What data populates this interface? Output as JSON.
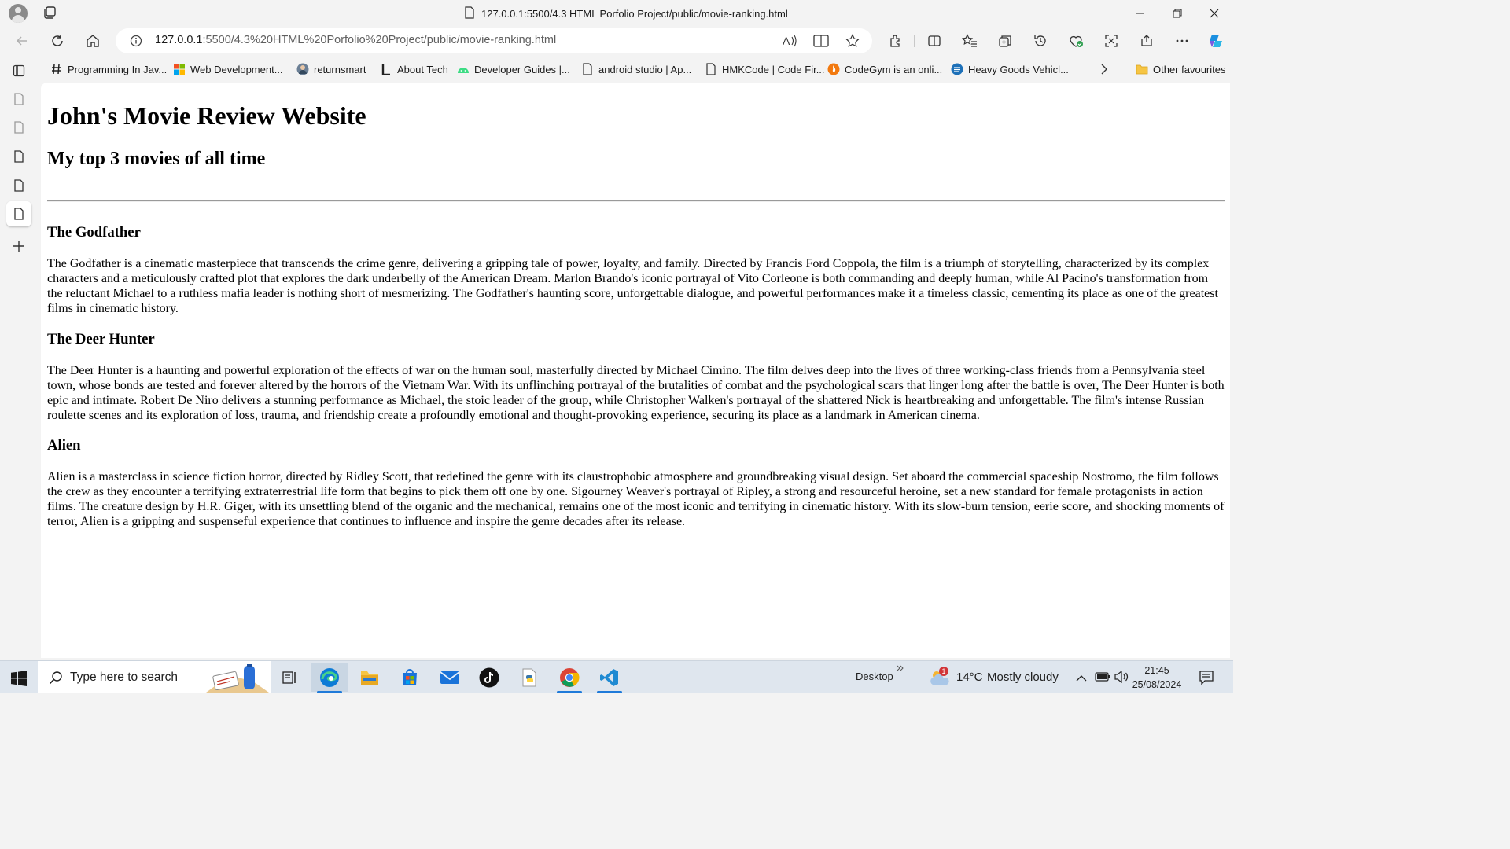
{
  "window": {
    "title": "127.0.0.1:5500/4.3 HTML Porfolio Project/public/movie-ranking.html"
  },
  "address_bar": {
    "host": "127.0.0.1",
    "rest": ":5500/4.3%20HTML%20Porfolio%20Project/public/movie-ranking.html"
  },
  "favourites": [
    {
      "label": "Programming In Jav...",
      "icon": "hash-icon"
    },
    {
      "label": "Web Development...",
      "icon": "microsoft-logo-icon"
    },
    {
      "label": "returnsmart",
      "icon": "avatar-icon"
    },
    {
      "label": "About Tech",
      "icon": "l-logo-icon"
    },
    {
      "label": "Developer Guides |...",
      "icon": "android-icon"
    },
    {
      "label": "android studio | Ap...",
      "icon": "page-icon"
    },
    {
      "label": "HMKCode | Code Fir...",
      "icon": "page-icon"
    },
    {
      "label": "CodeGym is an onli...",
      "icon": "codegym-icon"
    },
    {
      "label": "Heavy Goods Vehicl...",
      "icon": "govuk-icon"
    }
  ],
  "favourites_other": "Other favourites",
  "page": {
    "h1": "John's Movie Review Website",
    "h2": "My top 3 movies of all time",
    "movies": [
      {
        "title": "The Godfather",
        "review": "The Godfather is a cinematic masterpiece that transcends the crime genre, delivering a gripping tale of power, loyalty, and family. Directed by Francis Ford Coppola, the film is a triumph of storytelling, characterized by its complex characters and a meticulously crafted plot that explores the dark underbelly of the American Dream. Marlon Brando's iconic portrayal of Vito Corleone is both commanding and deeply human, while Al Pacino's transformation from the reluctant Michael to a ruthless mafia leader is nothing short of mesmerizing. The Godfather's haunting score, unforgettable dialogue, and powerful performances make it a timeless classic, cementing its place as one of the greatest films in cinematic history."
      },
      {
        "title": "The Deer Hunter",
        "review": "The Deer Hunter is a haunting and powerful exploration of the effects of war on the human soul, masterfully directed by Michael Cimino. The film delves deep into the lives of three working-class friends from a Pennsylvania steel town, whose bonds are tested and forever altered by the horrors of the Vietnam War. With its unflinching portrayal of the brutalities of combat and the psychological scars that linger long after the battle is over, The Deer Hunter is both epic and intimate. Robert De Niro delivers a stunning performance as Michael, the stoic leader of the group, while Christopher Walken's portrayal of the shattered Nick is heartbreaking and unforgettable. The film's intense Russian roulette scenes and its exploration of loss, trauma, and friendship create a profoundly emotional and thought-provoking experience, securing its place as a landmark in American cinema."
      },
      {
        "title": "Alien",
        "review": "Alien is a masterclass in science fiction horror, directed by Ridley Scott, that redefined the genre with its claustrophobic atmosphere and groundbreaking visual design. Set aboard the commercial spaceship Nostromo, the film follows the crew as they encounter a terrifying extraterrestrial life form that begins to pick them off one by one. Sigourney Weaver's portrayal of Ripley, a strong and resourceful heroine, set a new standard for female protagonists in action films. The creature design by H.R. Giger, with its unsettling blend of the organic and the mechanical, remains one of the most iconic and terrifying in cinematic history. With its slow-burn tension, eerie score, and shocking moments of terror, Alien is a gripping and suspenseful experience that continues to influence and inspire the genre decades after its release."
      }
    ]
  },
  "taskbar": {
    "search_placeholder": "Type here to search",
    "desktop_label": "Desktop",
    "weather_temp": "14°C",
    "weather_text": "Mostly cloudy",
    "weather_badge": "1",
    "time": "21:45",
    "date": "25/08/2024"
  },
  "colors": {
    "accent": "#1f7ad9",
    "chrome_bg": "#f3f3f3",
    "taskbar_bg": "#dfe6ee"
  }
}
